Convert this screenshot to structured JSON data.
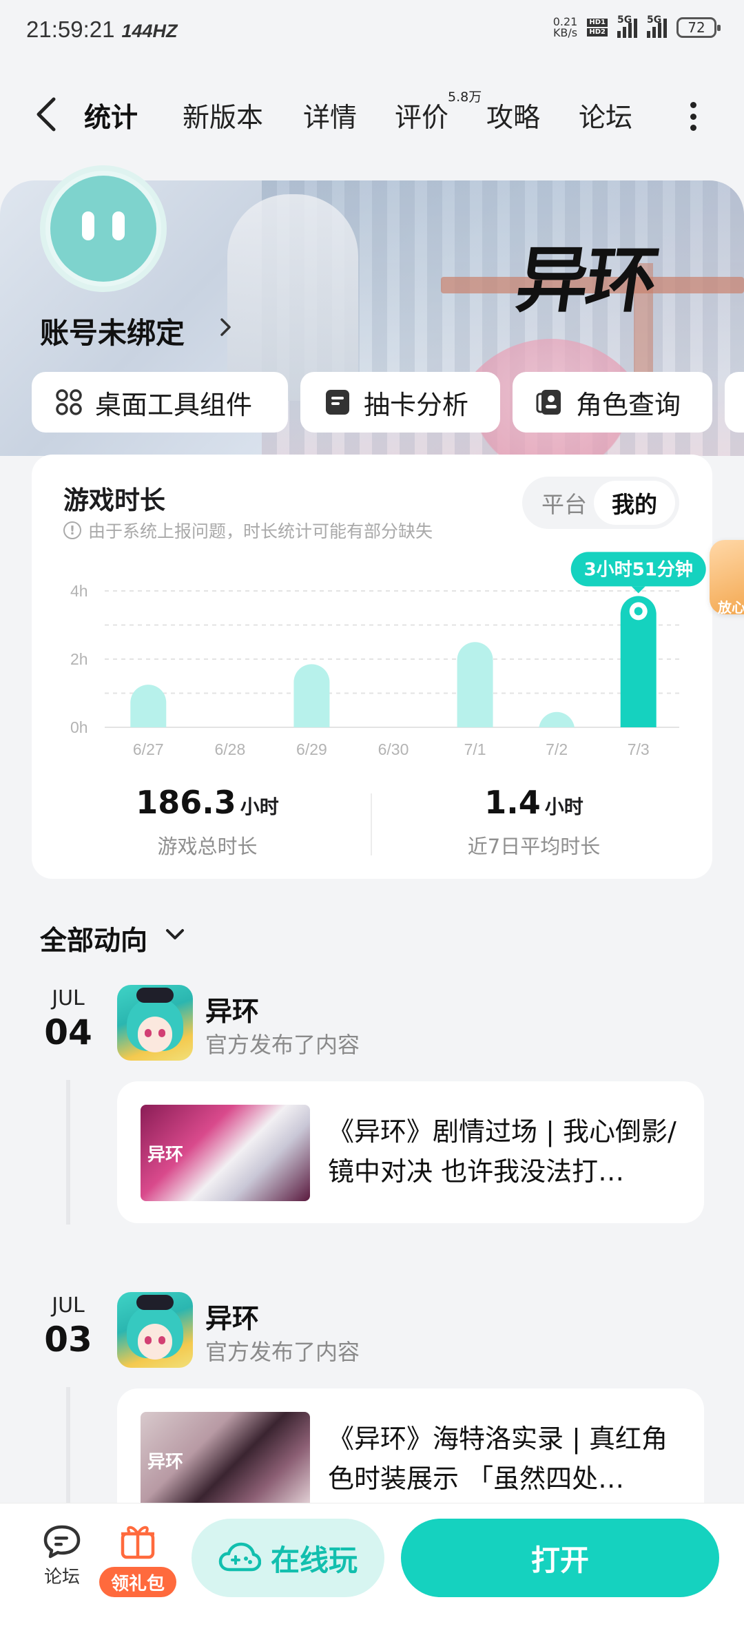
{
  "status": {
    "time": "21:59:21",
    "hz": "144HZ",
    "speed_top": "0.21",
    "speed_unit": "KB/s",
    "hd1": "HD1",
    "hd2": "HD2",
    "net1": "5G",
    "net2": "5G",
    "battery": "72"
  },
  "nav": {
    "tabs": [
      {
        "label": "统计",
        "active": true
      },
      {
        "label": "新版本"
      },
      {
        "label": "详情"
      },
      {
        "label": "评价",
        "badge": "5.8万"
      },
      {
        "label": "攻略"
      },
      {
        "label": "论坛"
      }
    ]
  },
  "banner": {
    "game_logo": "异环",
    "account_label": "账号未绑定"
  },
  "tools": [
    "桌面工具组件",
    "抽卡分析",
    "角色查询"
  ],
  "playtime": {
    "title": "游戏时长",
    "note": "由于系统上报问题，时长统计可能有部分缺失",
    "toggle": [
      "平台",
      "我的"
    ],
    "tooltip": "3小时51分钟",
    "total_value": "186.3",
    "total_unit": "小时",
    "total_label": "游戏总时长",
    "avg_value": "1.4",
    "avg_unit": "小时",
    "avg_label": "近7日平均时长"
  },
  "chart_data": {
    "type": "bar",
    "categories": [
      "6/27",
      "6/28",
      "6/29",
      "6/30",
      "7/1",
      "7/2",
      "7/3"
    ],
    "values": [
      1.25,
      0,
      1.85,
      0,
      2.5,
      0.45,
      3.85
    ],
    "yticks": [
      "0h",
      "2h",
      "4h"
    ],
    "ylim": [
      0,
      4
    ],
    "highlight_index": 6,
    "grid": true,
    "colors": {
      "bar": "#b7f1eb",
      "highlight": "#15d2bf"
    }
  },
  "feed": {
    "header": "全部动向",
    "items": [
      {
        "month": "JUL",
        "day": "04",
        "game": "异环",
        "action": "官方发布了内容",
        "thumb_logo": "异环",
        "text": "《异环》剧情过场 | 我心倒影/镜中对决 也许我没法打…"
      },
      {
        "month": "JUL",
        "day": "03",
        "game": "异环",
        "action": "官方发布了内容",
        "thumb_logo": "异环",
        "text": "《异环》海特洛实录 | 真红角色时装展示 「虽然四处…"
      }
    ]
  },
  "bottom": {
    "forum": "论坛",
    "gift": "领礼包",
    "cloud": "在线玩",
    "open": "打开"
  },
  "side_float": "放心"
}
